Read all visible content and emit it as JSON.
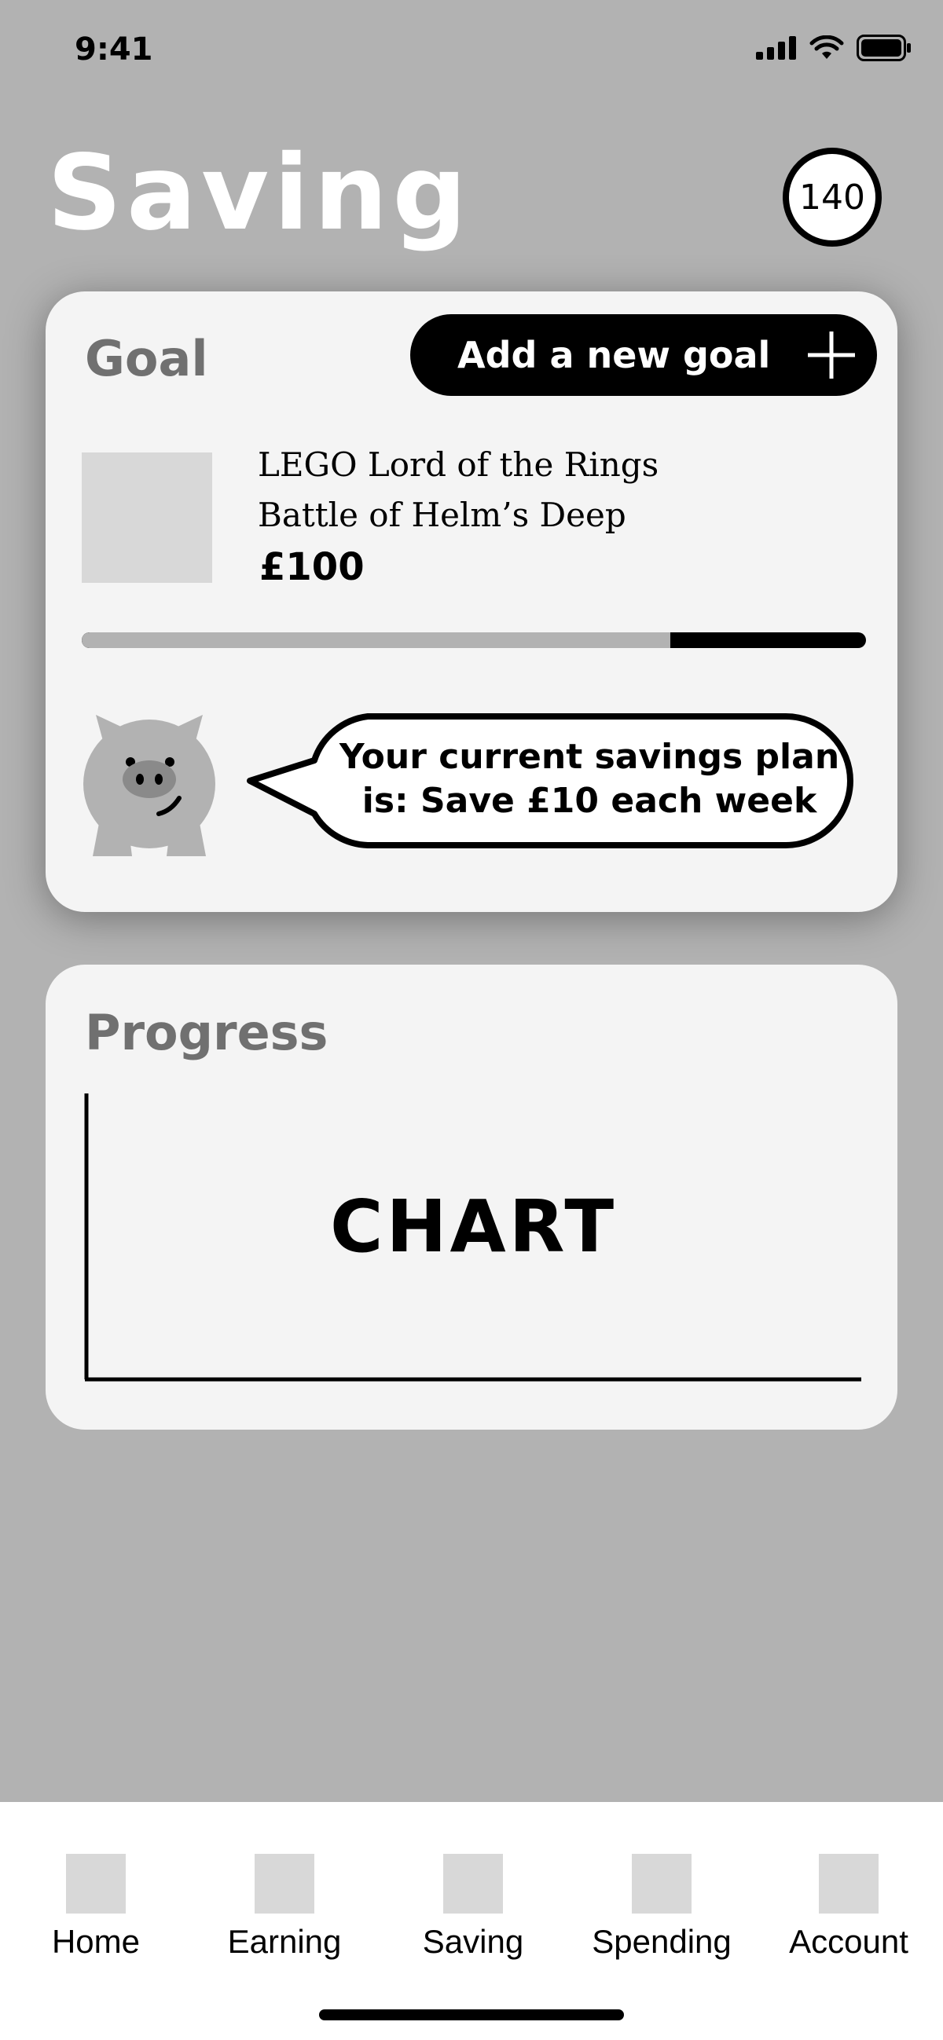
{
  "status_bar": {
    "time": "9:41"
  },
  "header": {
    "title": "Saving",
    "points": "140"
  },
  "goal": {
    "heading": "Goal",
    "add_button_label": "Add a new goal",
    "name_line1": "LEGO Lord of the Rings",
    "name_line2": "Battle of Helm’s Deep",
    "price": "£100",
    "progress_fraction": 0.75,
    "plan_line1": "Your current savings plan",
    "plan_line2": "is: Save £10 each week"
  },
  "progress": {
    "heading": "Progress",
    "chart_placeholder": "CHART"
  },
  "tabs": [
    {
      "label": "Home"
    },
    {
      "label": "Earning"
    },
    {
      "label": "Saving"
    },
    {
      "label": "Spending"
    },
    {
      "label": "Account"
    }
  ],
  "colors": {
    "background": "#b2b2b2",
    "card": "#f4f4f4",
    "accent": "#000000",
    "placeholder": "#d8d8d8"
  }
}
